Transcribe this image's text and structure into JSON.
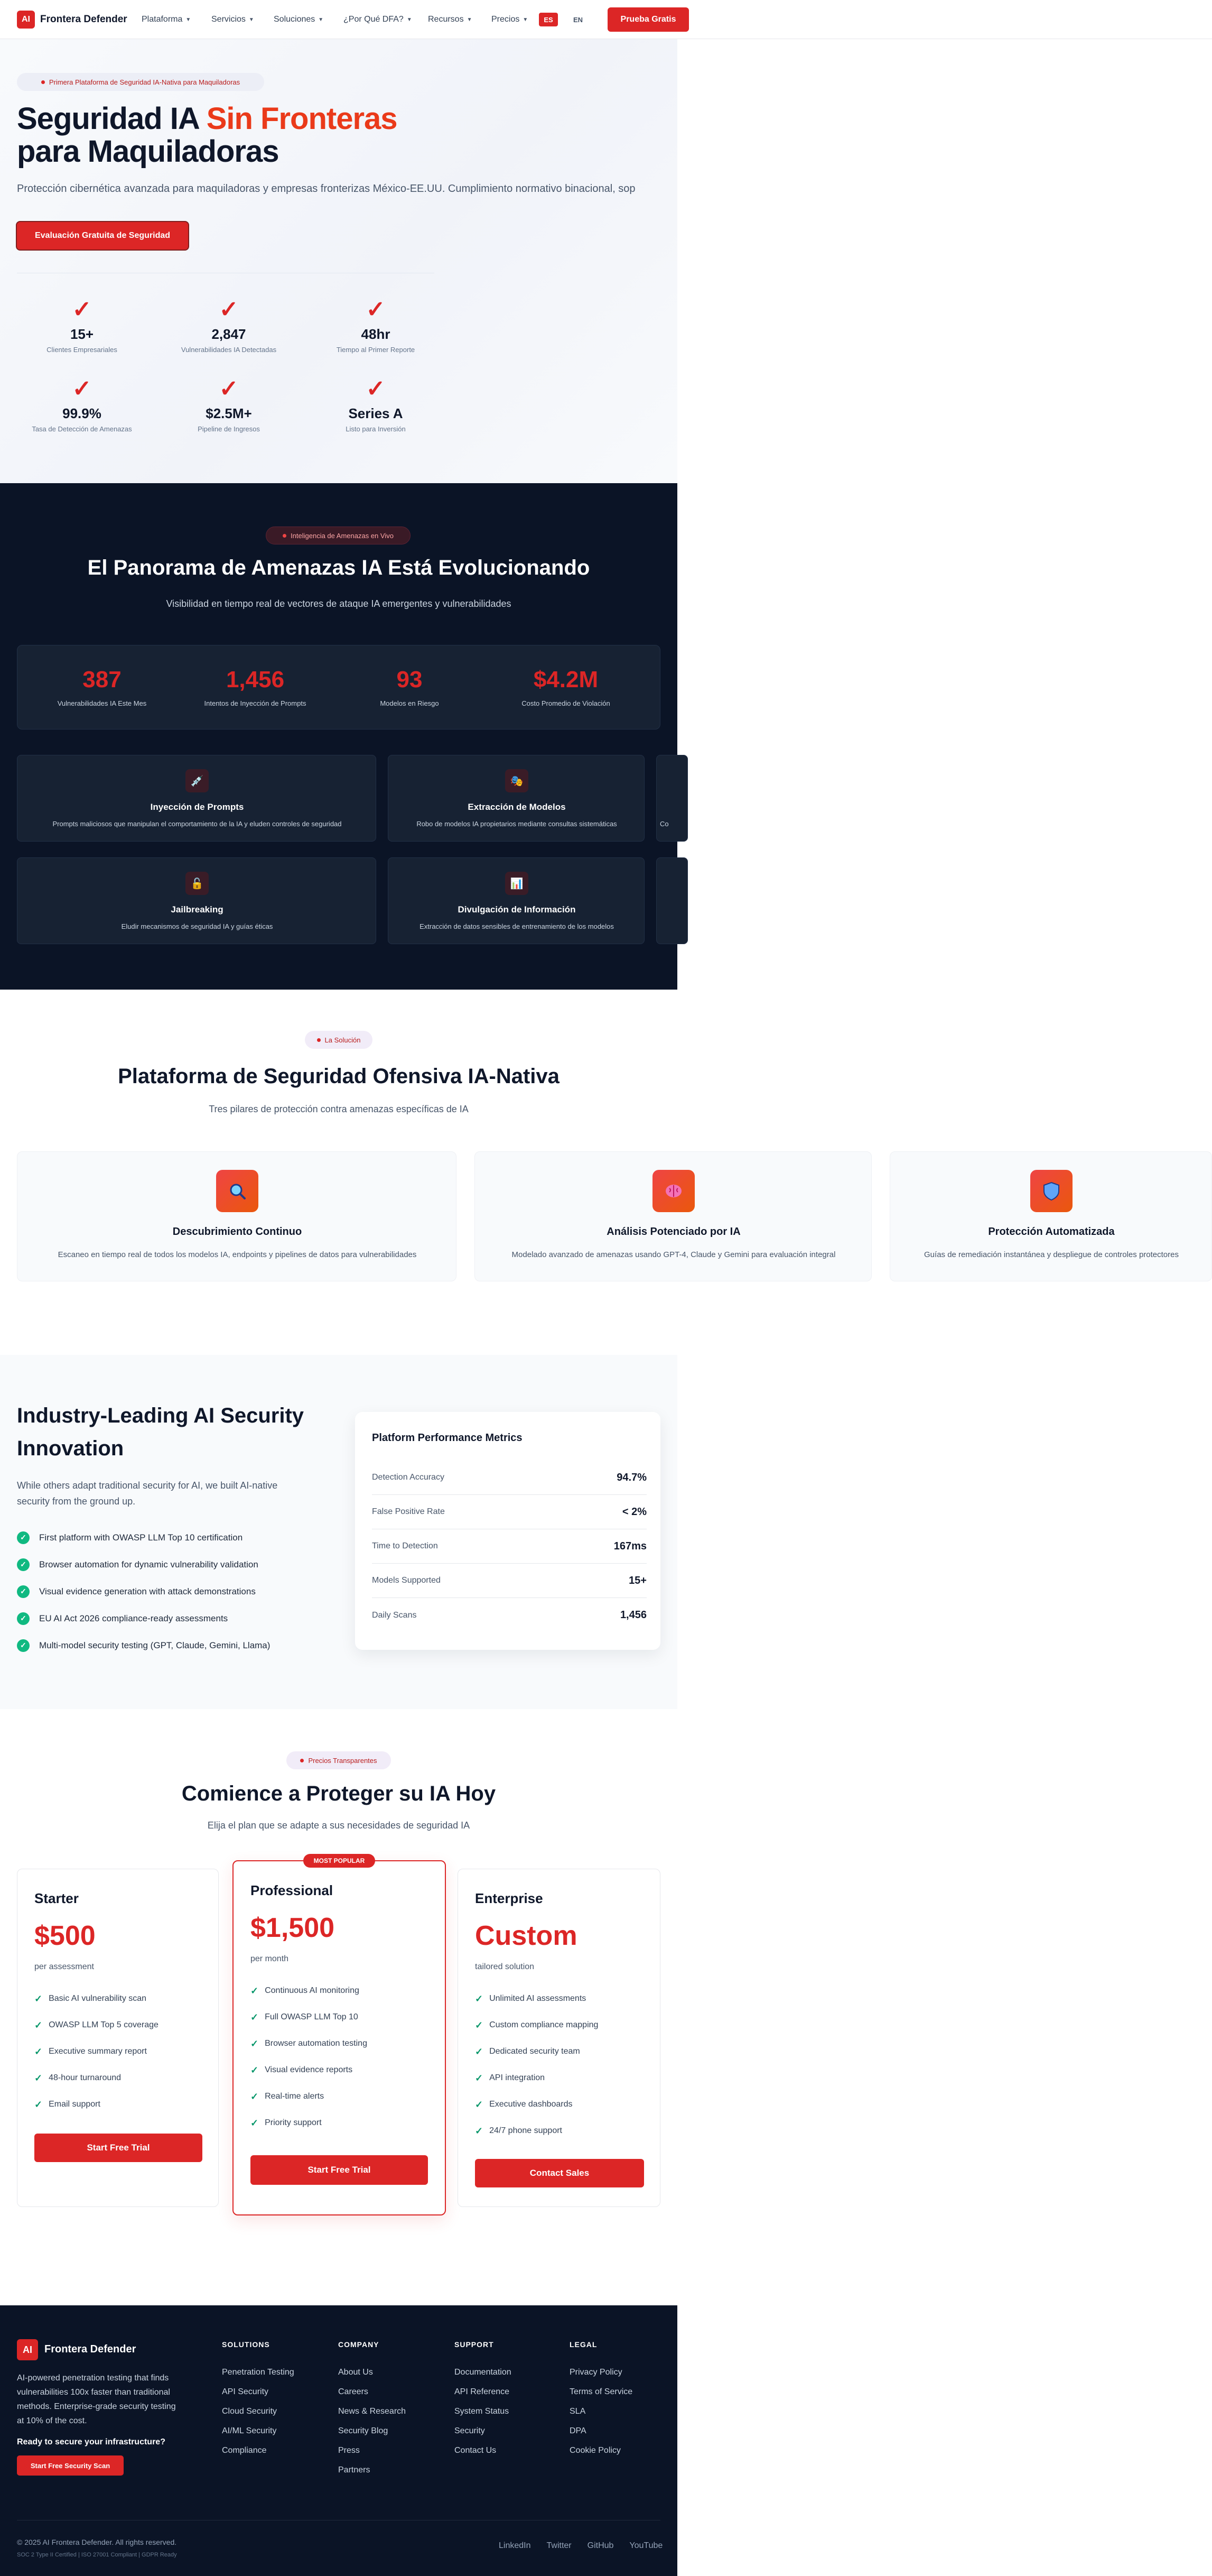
{
  "nav": {
    "logo_mark": "AI",
    "brand": "Frontera Defender",
    "items": [
      "Plataforma",
      "Servicios",
      "Soluciones",
      "¿Por Qué DFA?",
      "Recursos",
      "Precios"
    ],
    "lang_es": "ES",
    "lang_en": "EN",
    "cta": "Prueba Gratis"
  },
  "hero": {
    "badge": "Primera Plataforma de Seguridad IA-Nativa para Maquiladoras",
    "title_part1": "Seguridad IA ",
    "title_highlight": "Sin Fronteras",
    "title_line2": "para Maquiladoras",
    "subtitle": "Protección cibernética avanzada para maquiladoras y empresas fronterizas México-EE.UU. Cumplimiento normativo binacional, sop",
    "cta": "Evaluación Gratuita de Seguridad",
    "stats": [
      {
        "icon": "✓",
        "value": "15+",
        "label": "Clientes Empresariales"
      },
      {
        "icon": "✓",
        "value": "2,847",
        "label": "Vulnerabilidades IA Detectadas"
      },
      {
        "icon": "✓",
        "value": "48hr",
        "label": "Tiempo al Primer Reporte"
      },
      {
        "icon": "✓",
        "value": "99.9%",
        "label": "Tasa de Detección de Amenazas"
      },
      {
        "icon": "✓",
        "value": "$2.5M+",
        "label": "Pipeline de Ingresos"
      },
      {
        "icon": "✓",
        "value": "Series A",
        "label": "Listo para Inversión"
      }
    ]
  },
  "threat": {
    "badge": "Inteligencia de Amenazas en Vivo",
    "title": "El Panorama de Amenazas IA Está Evolucionando",
    "subtitle": "Visibilidad en tiempo real de vectores de ataque IA emergentes y vulnerabilidades",
    "stats": [
      {
        "value": "387",
        "label": "Vulnerabilidades IA Este Mes"
      },
      {
        "value": "1,456",
        "label": "Intentos de Inyección de Prompts"
      },
      {
        "value": "93",
        "label": "Modelos en Riesgo"
      },
      {
        "value": "$4.2M",
        "label": "Costo Promedio de Violación"
      }
    ],
    "cards": [
      {
        "icon": "💉",
        "title": "Inyección de Prompts",
        "desc": "Prompts maliciosos que manipulan el comportamiento de la IA y eluden controles de seguridad"
      },
      {
        "icon": "🎭",
        "title": "Extracción de Modelos",
        "desc": "Robo de modelos IA propietarios mediante consultas sistemáticas"
      },
      {
        "icon": "",
        "title": "",
        "desc": "Co"
      },
      {
        "icon": "🔓",
        "title": "Jailbreaking",
        "desc": "Eludir mecanismos de seguridad IA y guías éticas"
      },
      {
        "icon": "📊",
        "title": "Divulgación de Información",
        "desc": "Extracción de datos sensibles de entrenamiento de los modelos"
      },
      {
        "icon": "",
        "title": "",
        "desc": ""
      }
    ]
  },
  "solution": {
    "badge": "La Solución",
    "title": "Plataforma de Seguridad Ofensiva IA-Nativa",
    "subtitle": "Tres pilares de protección contra amenazas específicas de IA",
    "cards": [
      {
        "icon": "search-icon",
        "title": "Descubrimiento Continuo",
        "desc": "Escaneo en tiempo real de todos los modelos IA, endpoints y pipelines de datos para vulnerabilidades"
      },
      {
        "icon": "brain-icon",
        "title": "Análisis Potenciado por IA",
        "desc": "Modelado avanzado de amenazas usando GPT-4, Claude y Gemini para evaluación integral"
      },
      {
        "icon": "shield-icon",
        "title": "Protección Automatizada",
        "desc": "Guías de remediación instantánea y despliegue de controles protectores"
      }
    ]
  },
  "innovation": {
    "title_line1": "Industry-Leading AI Security",
    "title_line2": "Innovation",
    "desc_line1": "While others adapt traditional security for AI, we built AI-native",
    "desc_line2": "security from the ground up.",
    "features": [
      "First platform with OWASP LLM Top 10 certification",
      "Browser automation for dynamic vulnerability validation",
      "Visual evidence generation with attack demonstrations",
      "EU AI Act 2026 compliance-ready assessments",
      "Multi-model security testing (GPT, Claude, Gemini, Llama)"
    ],
    "metrics_title": "Platform Performance Metrics",
    "metrics": [
      {
        "label": "Detection Accuracy",
        "value": "94.7%"
      },
      {
        "label": "False Positive Rate",
        "value": "< 2%"
      },
      {
        "label": "Time to Detection",
        "value": "167ms"
      },
      {
        "label": "Models Supported",
        "value": "15+"
      },
      {
        "label": "Daily Scans",
        "value": "1,456"
      }
    ]
  },
  "pricing": {
    "badge": "Precios Transparentes",
    "title": "Comience a Proteger su IA Hoy",
    "subtitle": "Elija el plan que se adapte a sus necesidades de seguridad IA",
    "popular": "MOST POPULAR",
    "plans": [
      {
        "name": "Starter",
        "price": "$500",
        "period": "per assessment",
        "features": [
          "Basic AI vulnerability scan",
          "OWASP LLM Top 5 coverage",
          "Executive summary report",
          "48-hour turnaround",
          "Email support"
        ],
        "cta": "Start Free Trial"
      },
      {
        "name": "Professional",
        "price": "$1,500",
        "period": "per month",
        "features": [
          "Continuous AI monitoring",
          "Full OWASP LLM Top 10",
          "Browser automation testing",
          "Visual evidence reports",
          "Real-time alerts",
          "Priority support"
        ],
        "cta": "Start Free Trial"
      },
      {
        "name": "Enterprise",
        "price": "Custom",
        "period": "tailored solution",
        "features": [
          "Unlimited AI assessments",
          "Custom compliance mapping",
          "Dedicated security team",
          "API integration",
          "Executive dashboards",
          "24/7 phone support"
        ],
        "cta": "Contact Sales"
      }
    ]
  },
  "footer": {
    "logo_mark": "AI",
    "brand": "Frontera Defender",
    "desc": [
      "AI-powered penetration testing that finds",
      "vulnerabilities 100x faster than traditional",
      "methods. Enterprise-grade security testing",
      "at 10% of the cost."
    ],
    "ready": "Ready to secure your infrastructure?",
    "cta": "Start Free Security Scan",
    "columns": [
      {
        "title": "SOLUTIONS",
        "links": [
          "Penetration Testing",
          "API Security",
          "Cloud Security",
          "AI/ML Security",
          "Compliance"
        ]
      },
      {
        "title": "COMPANY",
        "links": [
          "About Us",
          "Careers",
          "News & Research",
          "Security Blog",
          "Press",
          "Partners"
        ]
      },
      {
        "title": "SUPPORT",
        "links": [
          "Documentation",
          "API Reference",
          "System Status",
          "Security",
          "Contact Us"
        ]
      },
      {
        "title": "LEGAL",
        "links": [
          "Privacy Policy",
          "Terms of Service",
          "SLA",
          "DPA",
          "Cookie Policy"
        ]
      }
    ],
    "copyright": "© 2025 AI Frontera Defender. All rights reserved.",
    "certs": "SOC 2 Type II Certified | ISO 27001 Compliant | GDPR Ready",
    "social": [
      "LinkedIn",
      "Twitter",
      "GitHub",
      "YouTube"
    ]
  }
}
